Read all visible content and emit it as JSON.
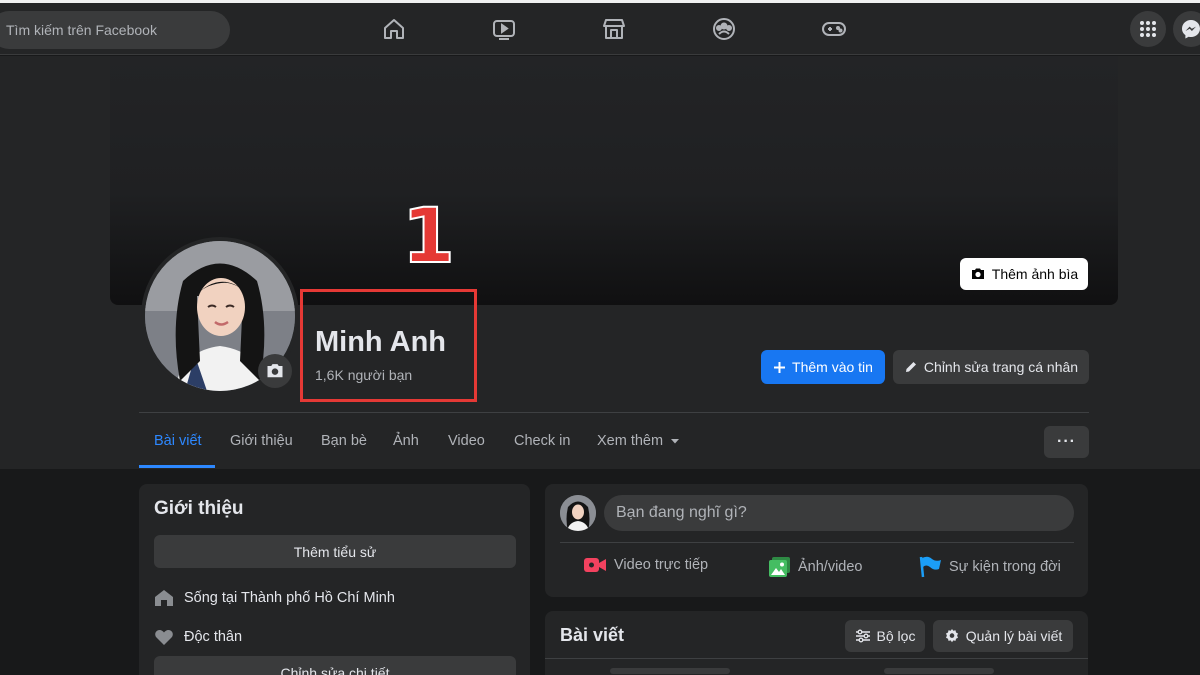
{
  "topbar": {
    "search_placeholder": "Tìm kiếm trên Facebook",
    "nav_icons": [
      "home-icon",
      "watch-icon",
      "marketplace-icon",
      "groups-icon",
      "gaming-icon"
    ],
    "right_icons": [
      "apps-menu-icon",
      "messenger-icon"
    ]
  },
  "cover": {
    "add_cover_label": "Thêm ảnh bìa"
  },
  "profile": {
    "name": "Minh Anh",
    "friends_count": "1,6K người bạn",
    "add_story_label": "Thêm vào tin",
    "edit_profile_label": "Chỉnh sửa trang cá nhân"
  },
  "annotation": {
    "number": "1",
    "color": "#e53935"
  },
  "tabs": [
    {
      "label": "Bài viết",
      "active": true
    },
    {
      "label": "Giới thiệu"
    },
    {
      "label": "Bạn bè"
    },
    {
      "label": "Ảnh"
    },
    {
      "label": "Video"
    },
    {
      "label": "Check in"
    },
    {
      "label": "Xem thêm"
    }
  ],
  "more_button_label": "···",
  "intro": {
    "title": "Giới thiệu",
    "add_bio_label": "Thêm tiểu sử",
    "lives_in": "Sống tại Thành phố Hồ Chí Minh",
    "relationship": "Độc thân",
    "edit_details_label": "Chỉnh sửa chi tiết"
  },
  "composer": {
    "placeholder": "Bạn đang nghĩ gì?",
    "live_video_label": "Video trực tiếp",
    "photo_video_label": "Ảnh/video",
    "life_event_label": "Sự kiện trong đời"
  },
  "posts": {
    "title": "Bài viết",
    "filter_label": "Bộ lọc",
    "manage_label": "Quản lý bài viết"
  },
  "colors": {
    "accent_blue": "#1877f2",
    "tab_active": "#2d88ff",
    "background": "#18191a",
    "card": "#242526",
    "live_red": "#f3425f",
    "photo_green": "#45bd62",
    "event_blue": "#1b9ef7"
  }
}
